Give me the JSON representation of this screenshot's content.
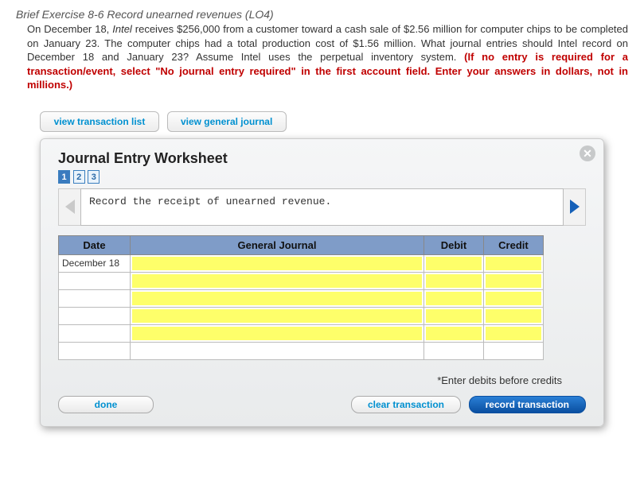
{
  "exercise_title": "Brief Exercise 8-6 Record unearned revenues (LO4)",
  "problem": {
    "line1a": "On December 18, ",
    "company": "Intel",
    "line1b": " receives $256,000 from a customer toward a cash sale of $2.56 million for computer chips to be completed on January 23. The computer chips had a total production cost of $1.56 million. What journal entries should Intel record on December 18 and January 23? Assume Intel uses the perpetual inventory system. ",
    "warning": "(If no entry is required for a transaction/event, select \"No journal entry required\" in the first account field. Enter your answers in dollars, not in millions.)"
  },
  "tabs": {
    "transaction_list": "view transaction list",
    "general_journal": "view general journal"
  },
  "worksheet": {
    "title": "Journal Entry Worksheet",
    "steps": [
      "1",
      "2",
      "3"
    ],
    "active_step": 0,
    "instruction": "Record the receipt of unearned revenue.",
    "columns": {
      "date": "Date",
      "gj": "General Journal",
      "debit": "Debit",
      "credit": "Credit"
    },
    "rows": [
      {
        "date": "December 18",
        "gj": "",
        "debit": "",
        "credit": ""
      },
      {
        "date": "",
        "gj": "",
        "debit": "",
        "credit": ""
      },
      {
        "date": "",
        "gj": "",
        "debit": "",
        "credit": ""
      },
      {
        "date": "",
        "gj": "",
        "debit": "",
        "credit": ""
      },
      {
        "date": "",
        "gj": "",
        "debit": "",
        "credit": ""
      },
      {
        "date": "",
        "gj": "",
        "debit": "",
        "credit": ""
      }
    ],
    "hint": "*Enter debits before credits",
    "buttons": {
      "done": "done",
      "clear": "clear transaction",
      "record": "record transaction"
    }
  }
}
